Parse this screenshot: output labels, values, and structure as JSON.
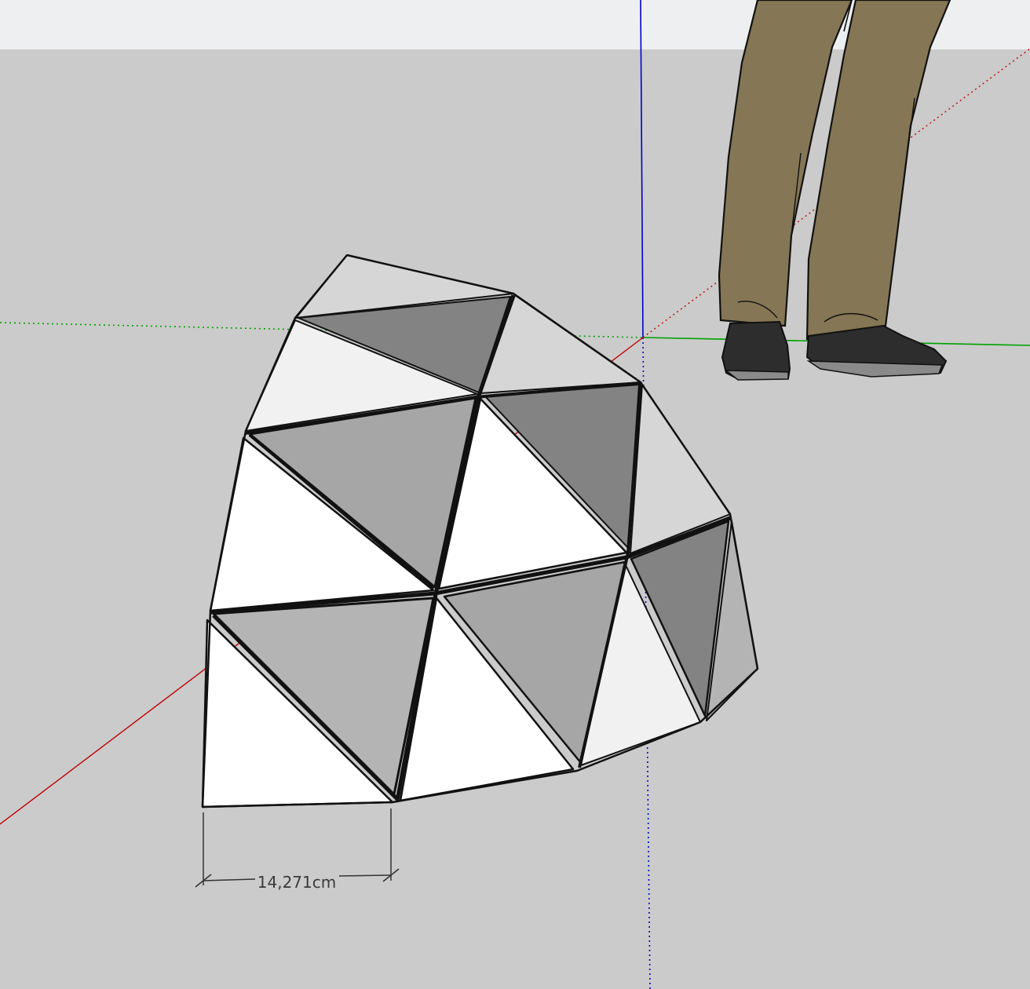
{
  "scene": {
    "sky_color": "#eeeff0",
    "ground_color": "#cbcbcb",
    "axes": {
      "red_axis_color": "#c00000",
      "green_axis_color": "#00a000",
      "blue_axis_color": "#0000c8"
    },
    "dimension": {
      "label": "14,271cm"
    },
    "model": {
      "name": "geodesic-dome-segment",
      "panel_colors": {
        "white": "#ffffff",
        "off_white": "#f1f1f1",
        "light_gray": "#d6d6d6",
        "mid_gray": "#a6a6a6",
        "gray": "#b4b4b4",
        "dark_gray": "#838383"
      }
    },
    "scale_figure": {
      "name": "person-scale-figure",
      "trouser_color": "#857655",
      "shoe_color": "#2d2d2d"
    }
  }
}
